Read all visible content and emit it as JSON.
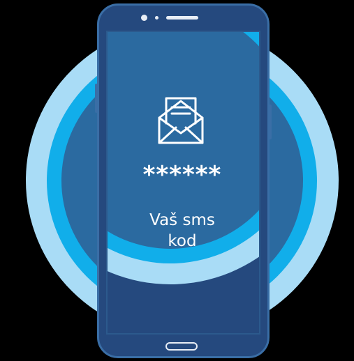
{
  "sms_screen": {
    "code_mask": "******",
    "caption_line1": "Vaš sms",
    "caption_line2": "kod"
  },
  "icons": {
    "envelope": "envelope-open-icon"
  },
  "colors": {
    "background": "#000000",
    "ring_outer": "#a9dcf6",
    "ring_middle": "#11aeea",
    "ring_inner": "#2b6aa0",
    "phone_body": "#25497e",
    "text": "#ffffff"
  }
}
